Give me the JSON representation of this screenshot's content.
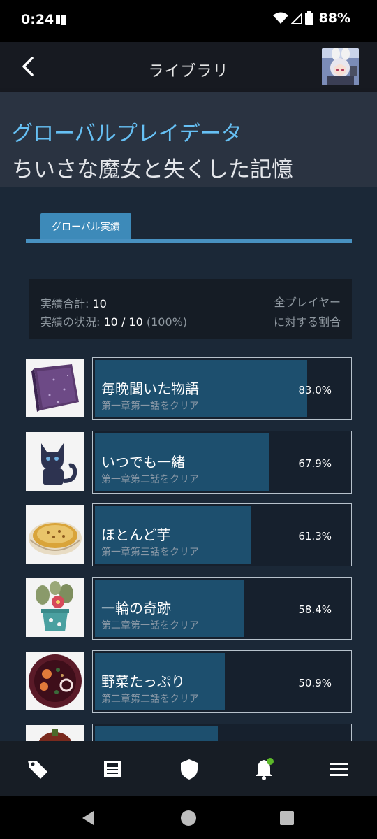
{
  "status": {
    "time": "0:24",
    "battery": "88%"
  },
  "header": {
    "title": "ライブラリ"
  },
  "banner": {
    "section": "グローバルプレイデータ",
    "game_title": "ちいさな魔女と失くした記憶"
  },
  "tab": {
    "label": "グローバル実績"
  },
  "summary": {
    "total_label": "実績合計:",
    "total_value": "10",
    "status_label": "実績の状況:",
    "status_value": "10 / 10",
    "status_pct": "(100%)",
    "right_line1": "全プレイヤー",
    "right_line2": "に対する割合"
  },
  "achievements": [
    {
      "name": "毎晩聞いた物語",
      "desc": "第一章第一話をクリア",
      "pct_label": "83.0%",
      "pct": 83.0,
      "icon": "purple-book-icon"
    },
    {
      "name": "いつでも一緒",
      "desc": "第一章第二話をクリア",
      "pct_label": "67.9%",
      "pct": 67.9,
      "icon": "black-cat-icon"
    },
    {
      "name": "ほとんど芋",
      "desc": "第一章第三話をクリア",
      "pct_label": "61.3%",
      "pct": 61.3,
      "icon": "gratin-dish-icon"
    },
    {
      "name": "一輪の奇跡",
      "desc": "第二章第一話をクリア",
      "pct_label": "58.4%",
      "pct": 58.4,
      "icon": "flower-pot-icon"
    },
    {
      "name": "野菜たっぷり",
      "desc": "第二章第二話をクリア",
      "pct_label": "50.9%",
      "pct": 50.9,
      "icon": "vegetable-soup-icon"
    }
  ],
  "bottom_nav": [
    "tag-icon",
    "news-icon",
    "shield-icon",
    "bell-icon",
    "menu-icon"
  ],
  "colors": {
    "accent": "#66c0f4",
    "bar": "#1d4f6e",
    "tab": "#3d8ab9",
    "notification": "#5cb82a"
  }
}
